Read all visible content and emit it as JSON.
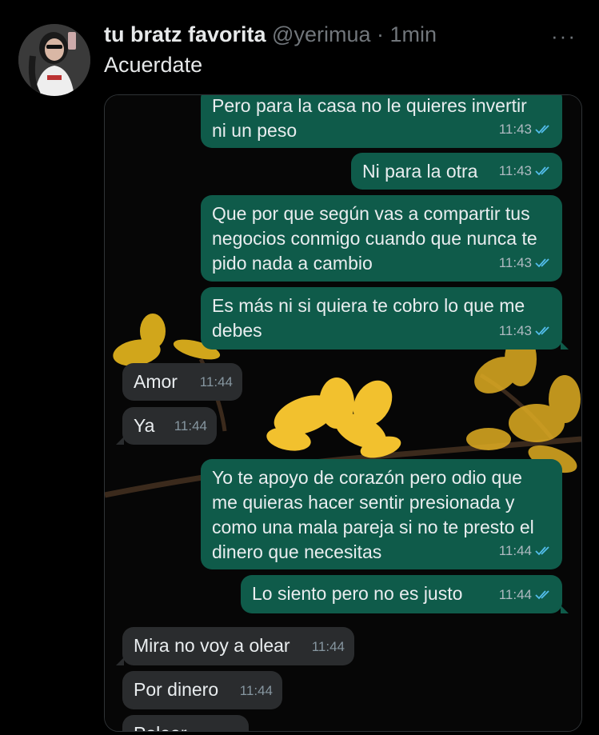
{
  "tweet": {
    "display_name": "tu bratz favorita",
    "handle": "@yerimua",
    "separator": "·",
    "time": "1min",
    "more": "···",
    "text": "Acuerdate"
  },
  "chat": {
    "messages": [
      {
        "dir": "out",
        "lines": [
          "Pero para la casa no le quieres invertir",
          "ni un peso"
        ],
        "time": "11:43",
        "read": true
      },
      {
        "dir": "out",
        "lines": [
          "Ni para la otra"
        ],
        "time": "11:43",
        "read": true
      },
      {
        "dir": "out",
        "lines": [
          "Que por que según vas a compartir tus",
          "negocios conmigo cuando que nunca te",
          "pido nada a cambio"
        ],
        "time": "11:43",
        "read": true
      },
      {
        "dir": "out",
        "lines": [
          "Es más ni si quiera te cobro lo que me",
          "debes"
        ],
        "time": "11:43",
        "read": true
      },
      {
        "dir": "in",
        "lines": [
          "Amor"
        ],
        "time": "11:44"
      },
      {
        "dir": "in",
        "lines": [
          "Ya"
        ],
        "time": "11:44"
      },
      {
        "dir": "out",
        "lines": [
          "Yo te apoyo de corazón pero odio que",
          "me quieras hacer sentir presionada y",
          "como una mala pareja si no te presto el",
          "dinero que necesitas"
        ],
        "time": "11:44",
        "read": true
      },
      {
        "dir": "out",
        "lines": [
          "Lo siento pero no es justo"
        ],
        "time": "11:44",
        "read": true
      },
      {
        "dir": "in",
        "lines": [
          "Mira no voy a olear"
        ],
        "time": "11:44"
      },
      {
        "dir": "in",
        "lines": [
          "Por dinero"
        ],
        "time": "11:44"
      },
      {
        "dir": "in",
        "lines": [
          "Polear"
        ],
        "time": ""
      }
    ]
  },
  "colors": {
    "outgoing": "#0f5b4a",
    "incoming": "#2a2c2e",
    "read_ticks": "#53bdeb",
    "flowers": "#f2c12e"
  }
}
